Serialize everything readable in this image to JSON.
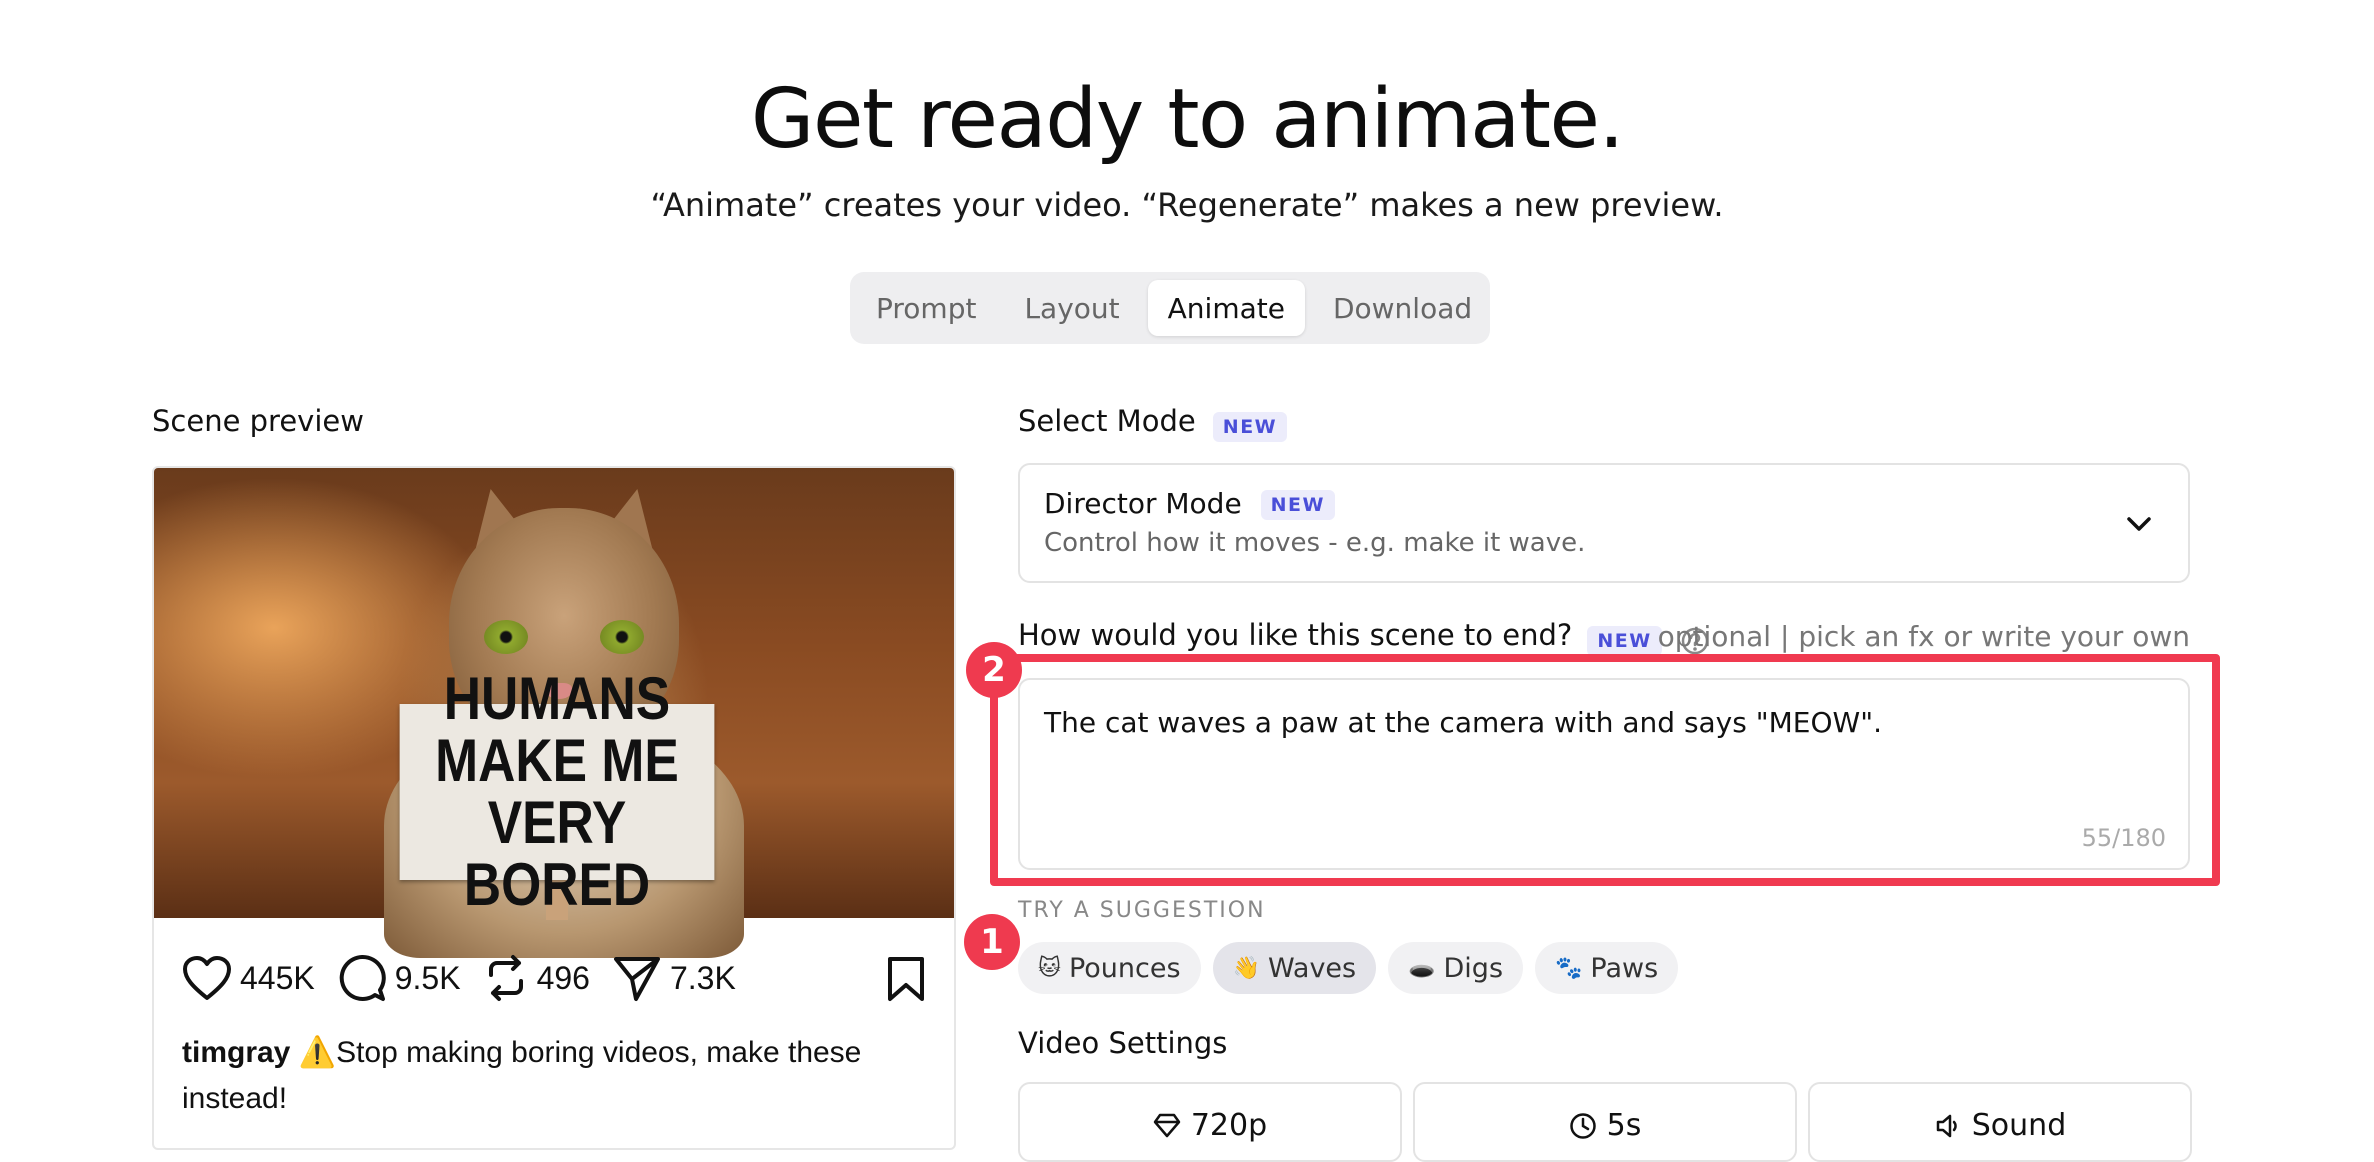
{
  "header": {
    "title": "Get ready to animate.",
    "subtitle": "“Animate” creates your video. “Regenerate” makes a new preview."
  },
  "tabs": [
    {
      "label": "Prompt",
      "active": false
    },
    {
      "label": "Layout",
      "active": false
    },
    {
      "label": "Animate",
      "active": true
    },
    {
      "label": "Download",
      "active": false
    }
  ],
  "preview": {
    "label": "Scene preview",
    "sign_text": "HUMANS MAKE ME VERY BORED",
    "stats": {
      "likes": "445K",
      "comments": "9.5K",
      "reposts": "496",
      "shares": "7.3K"
    },
    "caption_user": "timgray",
    "caption_warning_icon": "⚠️",
    "caption_text": "Stop making boring videos, make these instead!"
  },
  "mode": {
    "label": "Select Mode",
    "badge": "NEW",
    "selected_title": "Director Mode",
    "selected_badge": "NEW",
    "selected_desc": "Control how it moves - e.g. make it wave."
  },
  "ending": {
    "label": "How would you like this scene to end?",
    "badge": "NEW",
    "hint": "optional | pick an fx or write your own",
    "value": "The cat waves a paw at the camera with and says \"MEOW\".",
    "counter": "55/180"
  },
  "annotations": {
    "marker_1": "1",
    "marker_2": "2"
  },
  "suggestions": {
    "label": "TRY A SUGGESTION",
    "items": [
      {
        "emoji": "🐱",
        "label": "Pounces"
      },
      {
        "emoji": "👋",
        "label": "Waves"
      },
      {
        "emoji": "🕳️",
        "label": "Digs"
      },
      {
        "emoji": "🐾",
        "label": "Paws"
      }
    ]
  },
  "video_settings": {
    "label": "Video Settings",
    "resolution": "720p",
    "duration": "5s",
    "sound": "Sound"
  },
  "colors": {
    "accent": "#4a4fd8",
    "highlight": "#f03a50"
  }
}
